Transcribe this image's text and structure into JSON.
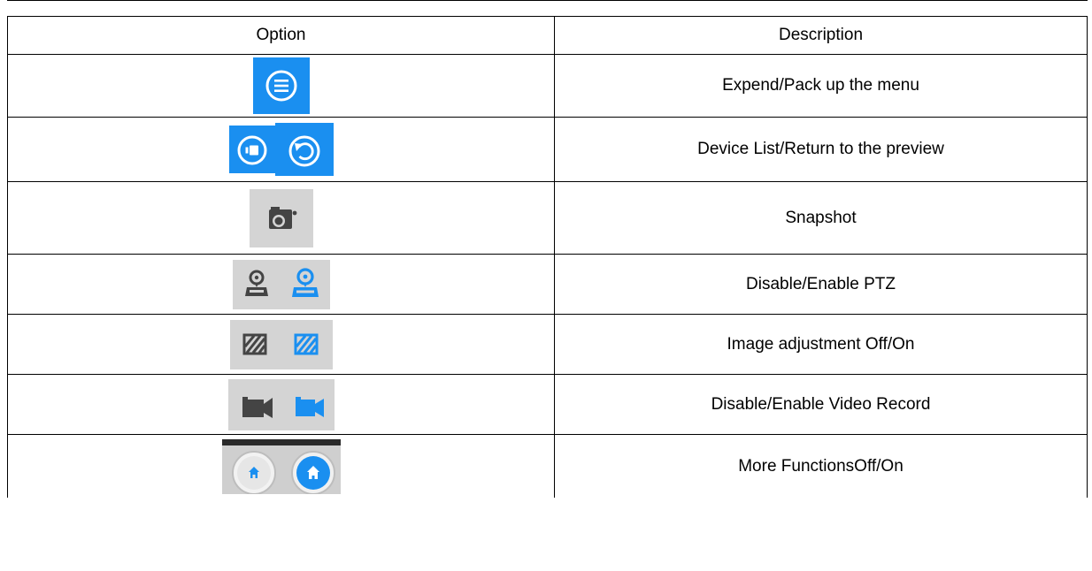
{
  "table": {
    "headers": {
      "option": "Option",
      "description": "Description"
    },
    "rows": [
      {
        "description": "Expend/Pack up the menu",
        "icons": [
          "menu-icon"
        ]
      },
      {
        "description": "Device List/Return to the preview",
        "icons": [
          "device-list-icon",
          "return-icon"
        ]
      },
      {
        "description": "Snapshot",
        "icons": [
          "camera-icon"
        ]
      },
      {
        "description": "Disable/Enable PTZ",
        "icons": [
          "ptz-off-icon",
          "ptz-on-icon"
        ]
      },
      {
        "description": "Image adjustment Off/On",
        "icons": [
          "image-adjust-off-icon",
          "image-adjust-on-icon"
        ]
      },
      {
        "description": "Disable/Enable Video Record",
        "icons": [
          "video-record-off-icon",
          "video-record-on-icon"
        ]
      },
      {
        "description": "More FunctionsOff/On",
        "icons": [
          "more-functions-off-icon",
          "more-functions-on-icon"
        ]
      }
    ]
  },
  "colors": {
    "blue": "#1a8ff0",
    "grey_tile": "#d4d4d4",
    "dark_icon": "#4a4a4a"
  }
}
